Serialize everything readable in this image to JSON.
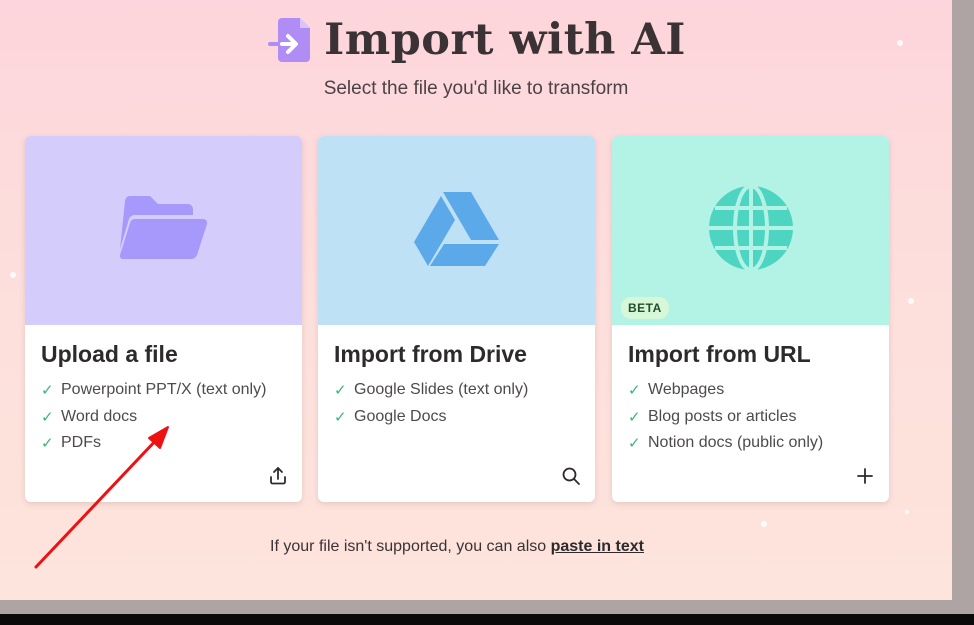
{
  "header": {
    "title": "Import with AI",
    "subtitle": "Select the file you'd like to transform"
  },
  "cards": [
    {
      "title": "Upload a file",
      "features": [
        "Powerpoint PPT/X (text only)",
        "Word docs",
        "PDFs"
      ],
      "icon": "folder-icon",
      "action_icon": "upload-icon",
      "color": "#d4cdfc"
    },
    {
      "title": "Import from Drive",
      "features": [
        "Google Slides (text only)",
        "Google Docs"
      ],
      "icon": "google-drive-icon",
      "action_icon": "search-icon",
      "color": "#bfe1f6"
    },
    {
      "title": "Import from URL",
      "badge": "BETA",
      "features": [
        "Webpages",
        "Blog posts or articles",
        "Notion docs (public only)"
      ],
      "icon": "globe-icon",
      "action_icon": "plus-icon",
      "color": "#b3f3e6"
    }
  ],
  "footer": {
    "text": "If your file isn't supported, you can also",
    "link": "paste in text"
  },
  "colors": {
    "accent": "#a78bfa",
    "check": "#3bb574",
    "annotation": "#ee1111"
  }
}
